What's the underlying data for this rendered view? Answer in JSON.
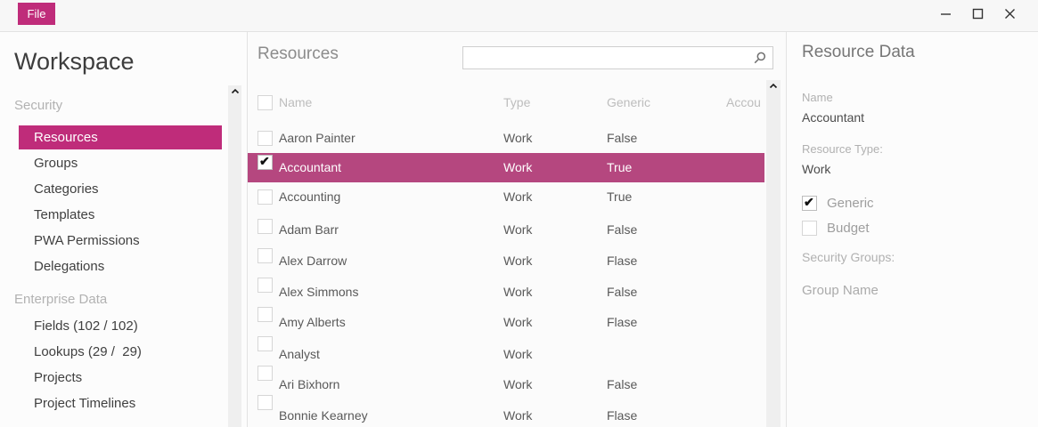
{
  "colors": {
    "accent": "#bf2c7a",
    "row_selected": "#b5477f",
    "titlebar_bg": "#f7f7f7",
    "panel_bg": "#fcfcfc"
  },
  "window": {
    "file_button": "File",
    "controls": [
      "minimize",
      "maximize",
      "close"
    ]
  },
  "sidebar": {
    "title": "Workspace",
    "sections": [
      {
        "label": "Security",
        "items": [
          {
            "label": "Resources",
            "selected": true
          },
          {
            "label": "Groups",
            "selected": false
          },
          {
            "label": "Categories",
            "selected": false
          },
          {
            "label": "Templates",
            "selected": false
          },
          {
            "label": "PWA Permissions",
            "selected": false
          },
          {
            "label": "Delegations",
            "selected": false
          }
        ]
      },
      {
        "label": "Enterprise Data",
        "items": [
          {
            "label": "Fields (102 / 102)",
            "selected": false
          },
          {
            "label": "Lookups (29 /  29)",
            "selected": false
          },
          {
            "label": "Projects",
            "selected": false
          },
          {
            "label": "Project Timelines",
            "selected": false
          }
        ]
      }
    ]
  },
  "resources_panel": {
    "title": "Resources",
    "search": {
      "value": "",
      "placeholder": ""
    },
    "columns": {
      "name": "Name",
      "type": "Type",
      "generic": "Generic",
      "account": "Accou"
    },
    "rows": [
      {
        "name": "Aaron Painter",
        "type": "Work",
        "generic": "False",
        "checked": false,
        "selected": false
      },
      {
        "name": "Accountant",
        "type": "Work",
        "generic": "True",
        "checked": true,
        "selected": true
      },
      {
        "name": "Accounting",
        "type": "Work",
        "generic": "True",
        "checked": false,
        "selected": false
      },
      {
        "name": "Adam Barr",
        "type": "Work",
        "generic": "False",
        "checked": false,
        "selected": false
      },
      {
        "name": "Alex Darrow",
        "type": "Work",
        "generic": "Flase",
        "checked": false,
        "selected": false
      },
      {
        "name": "Alex Simmons",
        "type": "Work",
        "generic": "False",
        "checked": false,
        "selected": false
      },
      {
        "name": "Amy Alberts",
        "type": "Work",
        "generic": "Flase",
        "checked": false,
        "selected": false
      },
      {
        "name": "Analyst",
        "type": "Work",
        "generic": "",
        "checked": false,
        "selected": false
      },
      {
        "name": "Ari Bixhorn",
        "type": "Work",
        "generic": "False",
        "checked": false,
        "selected": false
      },
      {
        "name": "Bonnie Kearney",
        "type": "Work",
        "generic": "Flase",
        "checked": false,
        "selected": false
      }
    ]
  },
  "detail_panel": {
    "title": "Resource Data",
    "name_label": "Name",
    "name_value": "Accountant",
    "type_label": "Resource Type:",
    "type_value": "Work",
    "generic_checkbox": {
      "label": "Generic",
      "checked": true
    },
    "budget_checkbox": {
      "label": "Budget",
      "checked": false
    },
    "groups_label": "Security Groups:",
    "group_name": "Group Name"
  }
}
